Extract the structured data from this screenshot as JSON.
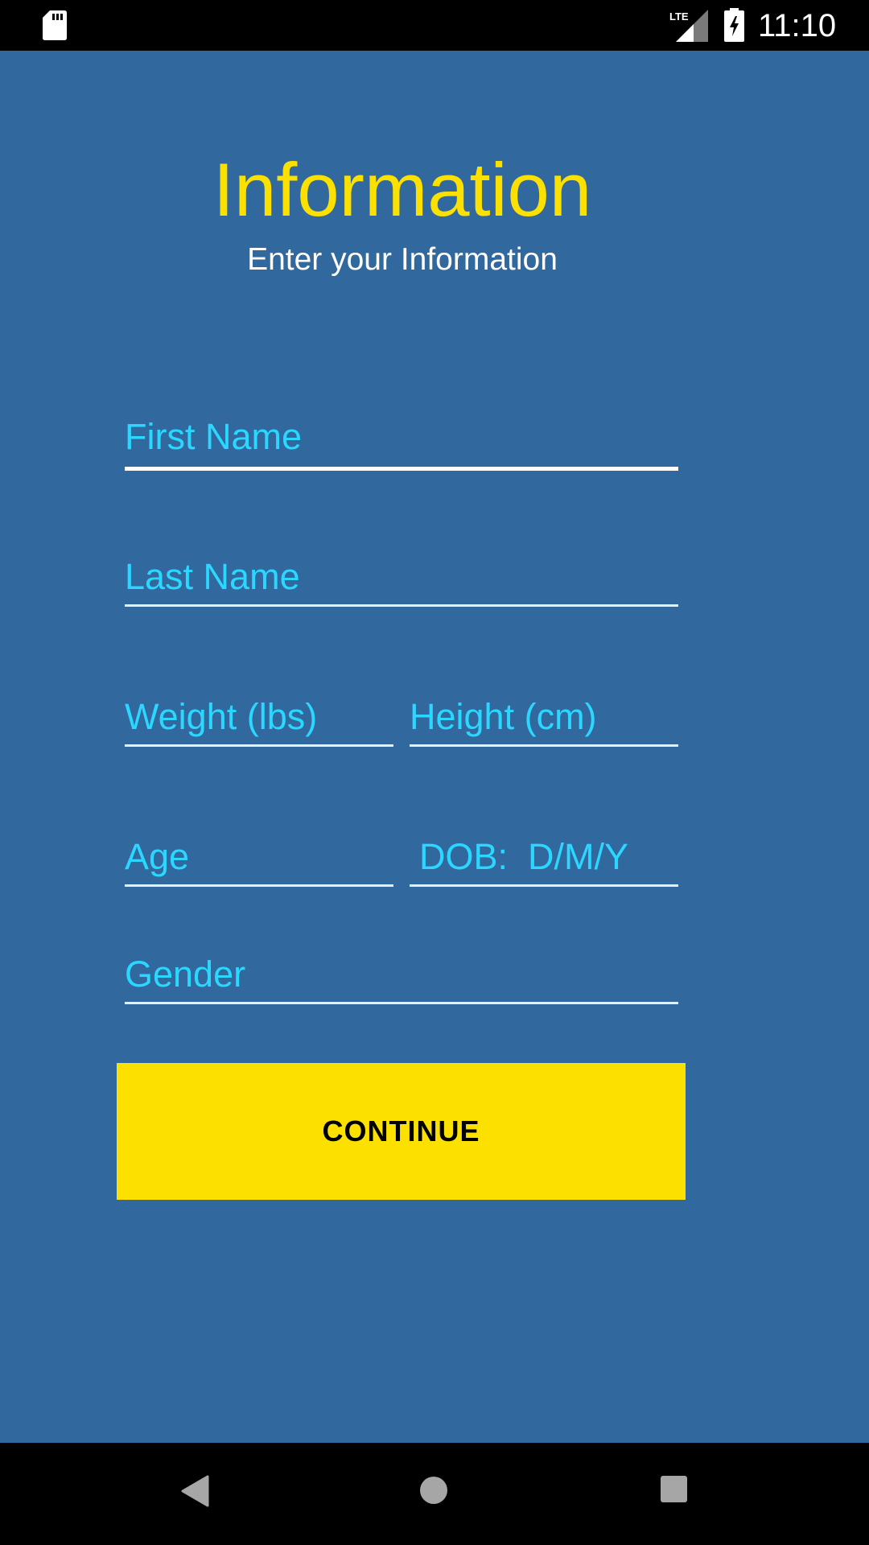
{
  "status_bar": {
    "time": "11:10",
    "sd_card_icon": "sd-card-icon",
    "network_label": "LTE",
    "signal_icon": "signal-icon",
    "battery_icon": "battery-charging-icon"
  },
  "header": {
    "title": "Information",
    "subtitle": "Enter your Information"
  },
  "form": {
    "first_name_placeholder": "First Name",
    "first_name_value": "",
    "last_name_placeholder": "Last Name",
    "last_name_value": "",
    "weight_placeholder": "Weight (lbs)",
    "weight_value": "",
    "height_placeholder": "Height (cm)",
    "height_value": "",
    "age_placeholder": "Age",
    "age_value": "",
    "dob_placeholder": "DOB:  D/M/Y",
    "dob_value": "",
    "gender_placeholder": "Gender",
    "gender_value": "",
    "continue_label": "CONTINUE"
  },
  "nav_bar": {
    "back_icon": "back-icon",
    "home_icon": "home-icon",
    "recents_icon": "recents-icon"
  },
  "colors": {
    "background": "#31689e",
    "title": "#fce000",
    "placeholder": "#2bd6ff",
    "button": "#fce000",
    "underline": "#ffffff"
  }
}
